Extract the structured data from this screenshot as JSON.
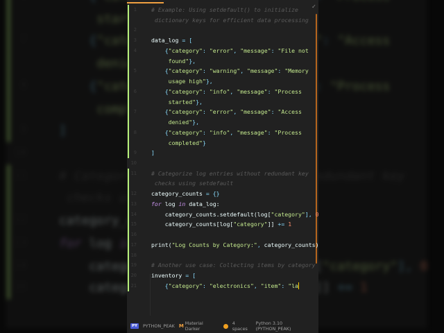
{
  "editor": {
    "lines": [
      {
        "n": "1",
        "rows": [
          [
            [
              "cm",
              "# Example: Using setdefault() to initialize"
            ]
          ],
          [
            [
              "cm",
              " dictionary keys for efficient data processing"
            ]
          ]
        ]
      },
      {
        "n": "2",
        "rows": [
          []
        ]
      },
      {
        "n": "3",
        "rows": [
          [
            [
              "tx",
              "data_log "
            ],
            [
              "pu",
              "= ["
            ]
          ]
        ]
      },
      {
        "n": "4",
        "rows": [
          [
            [
              "tx",
              "    "
            ],
            [
              "pu",
              "{"
            ],
            [
              "st",
              "\"category\""
            ],
            [
              "pu",
              ": "
            ],
            [
              "st",
              "\"error\""
            ],
            [
              "pu",
              ", "
            ],
            [
              "st",
              "\"message\""
            ],
            [
              "pu",
              ": "
            ],
            [
              "st",
              "\"File not"
            ]
          ],
          [
            [
              "st",
              "     found\""
            ],
            [
              "pu",
              "},"
            ]
          ]
        ]
      },
      {
        "n": "5",
        "rows": [
          [
            [
              "tx",
              "    "
            ],
            [
              "pu",
              "{"
            ],
            [
              "st",
              "\"category\""
            ],
            [
              "pu",
              ": "
            ],
            [
              "st",
              "\"warning\""
            ],
            [
              "pu",
              ", "
            ],
            [
              "st",
              "\"message\""
            ],
            [
              "pu",
              ": "
            ],
            [
              "st",
              "\"Memory"
            ]
          ],
          [
            [
              "st",
              "     usage high\""
            ],
            [
              "pu",
              "},"
            ]
          ]
        ]
      },
      {
        "n": "6",
        "rows": [
          [
            [
              "tx",
              "    "
            ],
            [
              "pu",
              "{"
            ],
            [
              "st",
              "\"category\""
            ],
            [
              "pu",
              ": "
            ],
            [
              "st",
              "\"info\""
            ],
            [
              "pu",
              ", "
            ],
            [
              "st",
              "\"message\""
            ],
            [
              "pu",
              ": "
            ],
            [
              "st",
              "\"Process"
            ]
          ],
          [
            [
              "st",
              "     started\""
            ],
            [
              "pu",
              "},"
            ]
          ]
        ]
      },
      {
        "n": "7",
        "rows": [
          [
            [
              "tx",
              "    "
            ],
            [
              "pu",
              "{"
            ],
            [
              "st",
              "\"category\""
            ],
            [
              "pu",
              ": "
            ],
            [
              "st",
              "\"error\""
            ],
            [
              "pu",
              ", "
            ],
            [
              "st",
              "\"message\""
            ],
            [
              "pu",
              ": "
            ],
            [
              "st",
              "\"Access"
            ]
          ],
          [
            [
              "st",
              "     denied\""
            ],
            [
              "pu",
              "},"
            ]
          ]
        ]
      },
      {
        "n": "8",
        "rows": [
          [
            [
              "tx",
              "    "
            ],
            [
              "pu",
              "{"
            ],
            [
              "st",
              "\"category\""
            ],
            [
              "pu",
              ": "
            ],
            [
              "st",
              "\"info\""
            ],
            [
              "pu",
              ", "
            ],
            [
              "st",
              "\"message\""
            ],
            [
              "pu",
              ": "
            ],
            [
              "st",
              "\"Process"
            ]
          ],
          [
            [
              "st",
              "     completed\""
            ],
            [
              "pu",
              "}"
            ]
          ]
        ]
      },
      {
        "n": "9",
        "rows": [
          [
            [
              "pu",
              "]"
            ]
          ]
        ]
      },
      {
        "n": "10",
        "rows": [
          []
        ]
      },
      {
        "n": "11",
        "rows": [
          [
            [
              "cm",
              "# Categorize log entries without redundant key"
            ]
          ],
          [
            [
              "cm",
              " checks using setdefault"
            ]
          ]
        ]
      },
      {
        "n": "12",
        "rows": [
          [
            [
              "tx",
              "category_counts "
            ],
            [
              "pu",
              "= {}"
            ]
          ]
        ]
      },
      {
        "n": "13",
        "rows": [
          [
            [
              "kw",
              "for"
            ],
            [
              "tx",
              " log "
            ],
            [
              "kw",
              "in"
            ],
            [
              "tx",
              " data_log:"
            ]
          ]
        ]
      },
      {
        "n": "14",
        "rows": [
          [
            [
              "tx",
              "    category_counts.setdefault(log["
            ],
            [
              "st",
              "\"category\""
            ],
            [
              "pu",
              "], "
            ],
            [
              "nu",
              "0"
            ],
            [
              "tx",
              ")"
            ]
          ]
        ]
      },
      {
        "n": "15",
        "rows": [
          [
            [
              "tx",
              "    category_counts[log["
            ],
            [
              "st",
              "\"category\""
            ],
            [
              "tx",
              "]] "
            ],
            [
              "pu",
              "+= "
            ],
            [
              "nu",
              "1"
            ]
          ]
        ]
      },
      {
        "n": "16",
        "rows": [
          []
        ]
      },
      {
        "n": "17",
        "rows": [
          [
            [
              "tx",
              "print("
            ],
            [
              "st",
              "\"Log Counts by Category:\""
            ],
            [
              "pu",
              ", "
            ],
            [
              "tx",
              "category_counts)"
            ]
          ]
        ]
      },
      {
        "n": "18",
        "rows": [
          []
        ]
      },
      {
        "n": "19",
        "rows": [
          [
            [
              "cm",
              "# Another use case: Collecting items by category"
            ]
          ]
        ]
      },
      {
        "n": "20",
        "rows": [
          [
            [
              "tx",
              "inventory "
            ],
            [
              "pu",
              "= ["
            ]
          ]
        ]
      },
      {
        "n": "21",
        "rows": [
          [
            [
              "tx",
              "    "
            ],
            [
              "pu",
              "{"
            ],
            [
              "st",
              "\"category\""
            ],
            [
              "pu",
              ": "
            ],
            [
              "st",
              "\"electronics\""
            ],
            [
              "pu",
              ", "
            ],
            [
              "st",
              "\"item\""
            ],
            [
              "pu",
              ": "
            ],
            [
              "st",
              "\"la"
            ]
          ]
        ]
      }
    ],
    "modified_lines": [
      "1",
      "2",
      "3",
      "4",
      "5",
      "6",
      "7",
      "8",
      "9",
      "11",
      "12",
      "13",
      "14",
      "15",
      "16",
      "17",
      "18",
      "19",
      "20",
      "21"
    ],
    "cursor_line": "21"
  },
  "status": {
    "project_badge": "PY",
    "project": "PYTHON_PEAK",
    "theme_icon": "M",
    "theme": "Material Darker",
    "indent": "4 spaces",
    "interpreter": "Python 3.10 (PYTHON_PEAK)"
  },
  "colors": {
    "accent": "#f0a040",
    "gutter_added": "#b6f07a",
    "background": "#212121"
  }
}
